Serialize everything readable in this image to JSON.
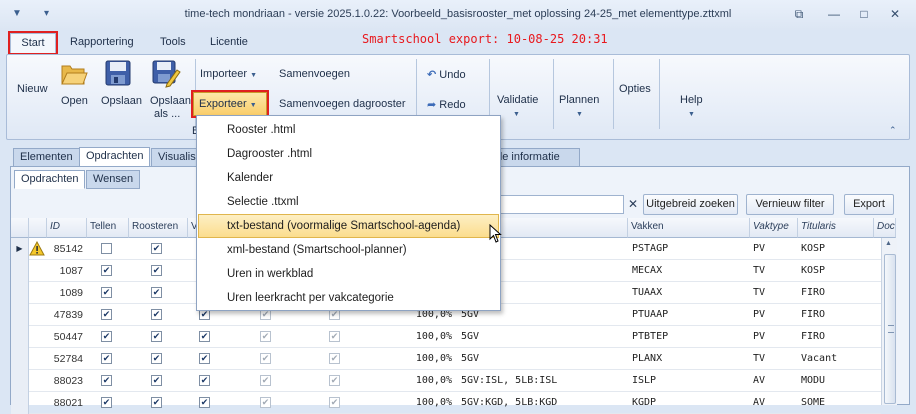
{
  "window": {
    "title": "time-tech mondriaan - versie 2025.1.0.22: Voorbeeld_basisrooster_met oplossing 24-25_met elementtype.zttxml",
    "controls": [
      "restore-icon",
      "minimize-icon",
      "maximize-icon",
      "close-icon"
    ]
  },
  "menu_tabs": [
    "Start",
    "Rapportering",
    "Tools",
    "Licentie"
  ],
  "export_note": "Smartschool export: 10-08-25 20:31",
  "ribbon": {
    "nieuw": "Nieuw",
    "open": "Open",
    "opslaan": "Opslaan",
    "opslaan_als_1": "Opslaan",
    "opslaan_als_2": "als ...",
    "importeer": "Importeer",
    "exporteer": "Exporteer",
    "samenvoegen": "Samenvoegen",
    "samenvoegen_dagrooster": "Samenvoegen dagrooster",
    "undo": "Undo",
    "redo": "Redo",
    "validatie": "Validatie",
    "plannen": "Plannen",
    "opties": "Opties",
    "help": "Help",
    "group_label_partial": "B"
  },
  "content_tabs": {
    "main": [
      "Elementen",
      "Opdrachten",
      "Visualisa",
      "nde informatie"
    ],
    "sub": [
      "Opdrachten",
      "Wensen"
    ]
  },
  "toolbar": {
    "uitgebreid_zoeken": "Uitgebreid zoeken",
    "vernieuw_filter": "Vernieuw filter",
    "export": "Export",
    "search_value": ""
  },
  "grid": {
    "headers": {
      "id": "ID",
      "tellen": "Tellen",
      "roosteren": "Roosteren",
      "v": "V",
      "vakken": "Vakken",
      "vaktype": "Vaktype",
      "titularis": "Titularis",
      "doc": "Doc"
    },
    "rows": [
      {
        "id": "85142",
        "tellen": false,
        "roosteren": true,
        "warning": true,
        "percent": "",
        "klas": "",
        "vak": "PSTAGP",
        "vaktype": "PV",
        "titularis": "KOSP"
      },
      {
        "id": "1087",
        "tellen": true,
        "roosteren": true,
        "warning": false,
        "percent": "",
        "klas": "",
        "vak": "MECAX",
        "vaktype": "TV",
        "titularis": "KOSP"
      },
      {
        "id": "1089",
        "tellen": true,
        "roosteren": true,
        "warning": false,
        "percent": "",
        "klas": "",
        "vak": "TUAAX",
        "vaktype": "TV",
        "titularis": "FIRO"
      },
      {
        "id": "47839",
        "tellen": true,
        "roosteren": true,
        "warning": false,
        "percent": "100,0%",
        "klas": "5GV",
        "vak": "PTUAAP",
        "vaktype": "PV",
        "titularis": "FIRO"
      },
      {
        "id": "50447",
        "tellen": true,
        "roosteren": true,
        "warning": false,
        "percent": "100,0%",
        "klas": "5GV",
        "vak": "PTBTEP",
        "vaktype": "PV",
        "titularis": "FIRO"
      },
      {
        "id": "52784",
        "tellen": true,
        "roosteren": true,
        "warning": false,
        "percent": "100,0%",
        "klas": "5GV",
        "vak": "PLANX",
        "vaktype": "TV",
        "titularis": "Vacant"
      },
      {
        "id": "88023",
        "tellen": true,
        "roosteren": true,
        "warning": false,
        "percent": "100,0%",
        "klas": "5GV:ISL, 5LB:ISL",
        "vak": "ISLP",
        "vaktype": "AV",
        "titularis": "MODU"
      },
      {
        "id": "88021",
        "tellen": true,
        "roosteren": true,
        "warning": false,
        "percent": "100,0%",
        "klas": "5GV:KGD, 5LB:KGD",
        "vak": "KGDP",
        "vaktype": "AV",
        "titularis": "SOME"
      }
    ]
  },
  "export_menu": [
    "Rooster .html",
    "Dagrooster .html",
    "Kalender",
    "Selectie .ttxml",
    "txt-bestand (voormalige Smartschool-agenda)",
    "xml-bestand (Smartschool-planner)",
    "Uren in werkblad",
    "Uren leerkracht per vakcategorie"
  ],
  "export_menu_hover_index": 4
}
